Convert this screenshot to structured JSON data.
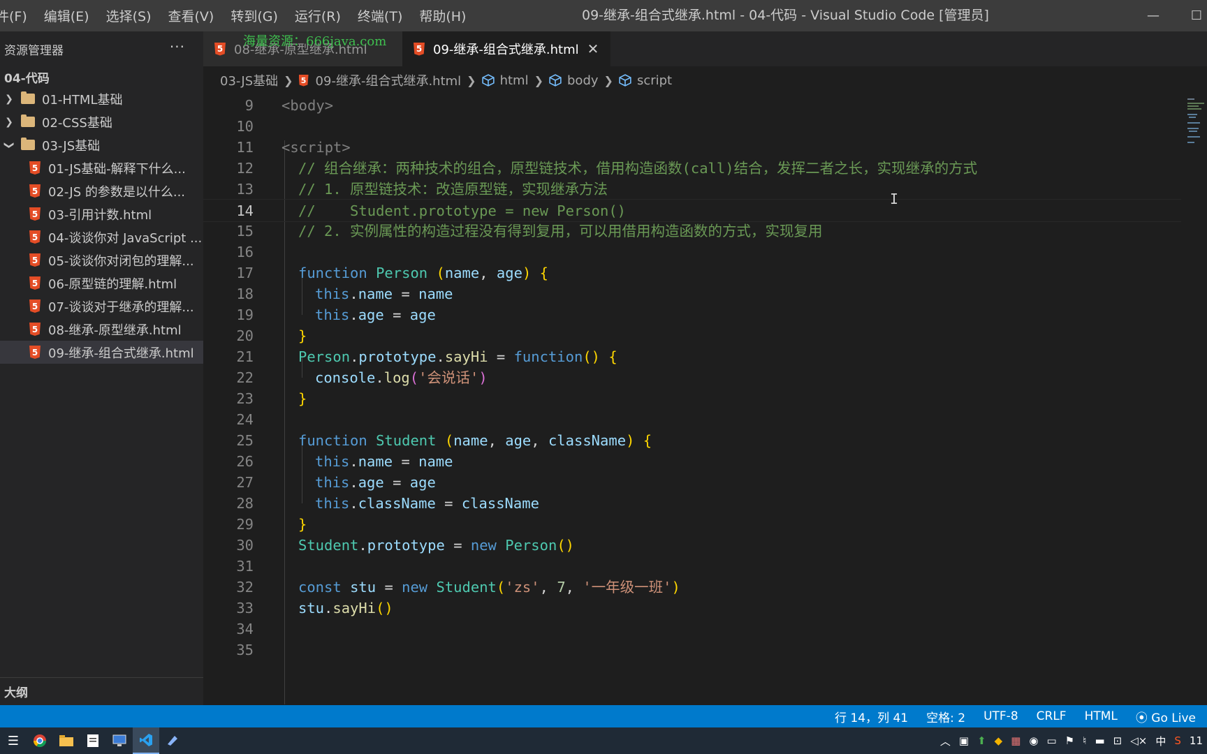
{
  "menu": [
    "件(F)",
    "编辑(E)",
    "选择(S)",
    "查看(V)",
    "转到(G)",
    "运行(R)",
    "终端(T)",
    "帮助(H)"
  ],
  "window_title": "09-继承-组合式继承.html - 04-代码 - Visual Studio Code [管理员]",
  "sidebar": {
    "title": "资源管理器",
    "more": "···",
    "project": "04-代码",
    "folders": [
      "01-HTML基础",
      "02-CSS基础",
      "03-JS基础"
    ],
    "files": [
      "01-JS基础-解释下什么...",
      "02-JS 的参数是以什么...",
      "03-引用计数.html",
      "04-谈谈你对 JavaScript ...",
      "05-谈谈你对闭包的理解...",
      "06-原型链的理解.html",
      "07-谈谈对于继承的理解...",
      "08-继承-原型继承.html",
      "09-继承-组合式继承.html"
    ],
    "outline": "大纲"
  },
  "tabs": [
    {
      "label": "08-继承-原型继承.html"
    },
    {
      "label": "09-继承-组合式继承.html"
    }
  ],
  "watermark": "海量资源：666java.com",
  "breadcrumb": [
    "03-JS基础",
    "09-继承-组合式继承.html",
    "html",
    "body",
    "script"
  ],
  "line_numbers": [
    "9",
    "10",
    "11",
    "12",
    "13",
    "14",
    "15",
    "16",
    "17",
    "18",
    "19",
    "20",
    "21",
    "22",
    "23",
    "24",
    "25",
    "26",
    "27",
    "28",
    "29",
    "30",
    "31",
    "32",
    "33",
    "34",
    "35"
  ],
  "code": {
    "l9": "<body>",
    "l11": "<script>",
    "l12": "// 组合继承：两种技术的组合，原型链技术，借用构造函数(call)结合，发挥二者之长，实现继承的方式",
    "l13": "// 1. 原型链技术：改造原型链，实现继承方法",
    "l14": "//    Student.prototype = new Person()",
    "l15": "// 2. 实例属性的构造过程没有得到复用，可以用借用构造函数的方式，实现复用",
    "kw_function": "function",
    "kw_this": "this",
    "kw_new": "new",
    "kw_const": "const",
    "person": "Person",
    "student": "Student",
    "name": "name",
    "age": "age",
    "className": "className",
    "prototype": "prototype",
    "sayHi": "sayHi",
    "console": "console",
    "log": "log",
    "str_say": "'会说话'",
    "stu": "stu",
    "str_zs": "'zs'",
    "num_7": "7",
    "str_class": "'一年级一班'"
  },
  "status": {
    "position": "行 14，列 41",
    "spaces": "空格: 2",
    "encoding": "UTF-8",
    "eol": "CRLF",
    "language": "HTML",
    "golive": "Go Live"
  },
  "tray": {
    "ime": "中",
    "time": "11"
  }
}
